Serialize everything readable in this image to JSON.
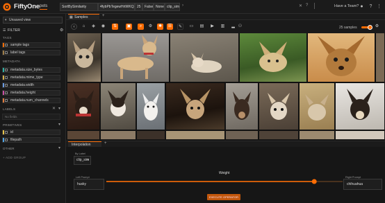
{
  "header": {
    "app_name": "FiftyOne",
    "dataset": "pets",
    "chips": [
      "SortBySimilarity",
      "4fybPbTegewHrtWKQZ57...",
      "25",
      "False",
      "None",
      "clip_sim"
    ],
    "team_label": "Have a Team?",
    "icons": [
      "github-icon",
      "help-icon",
      "more-icon"
    ]
  },
  "sidebar": {
    "view_select": "Unsaved view",
    "filter_label": "FILTER",
    "sections": {
      "tags": "TAGS",
      "metadata": "METADATA",
      "labels": "LABELS",
      "primitives": "PRIMITIVES",
      "other": "OTHER"
    },
    "tag_items": [
      "sample tags",
      "label tags"
    ],
    "metadata_items": [
      "metadata.size_bytes",
      "metadata.mime_type",
      "metadata.width",
      "metadata.height",
      "metadata.num_channels"
    ],
    "labels_empty": "No fields",
    "primitive_items": [
      "id",
      "filepath"
    ],
    "add_group": "+ ADD GROUP"
  },
  "main": {
    "tab_label": "Samples",
    "tab_add": "+",
    "sample_count": "25 samples"
  },
  "panel": {
    "tab_label": "Interpolation",
    "tab_add": "+",
    "select_label": "By Label",
    "select_value": "clip_sim",
    "weight_label": "Weight",
    "weight_value": 0.88,
    "left_label": "Left Prompt",
    "left_value": "husky",
    "right_label": "Right Prompt",
    "right_value": "chihuahua",
    "execute_label": "EXECUTE OPERATOR"
  },
  "colors": {
    "accent": "#ff6d04",
    "bg": "#151515"
  }
}
